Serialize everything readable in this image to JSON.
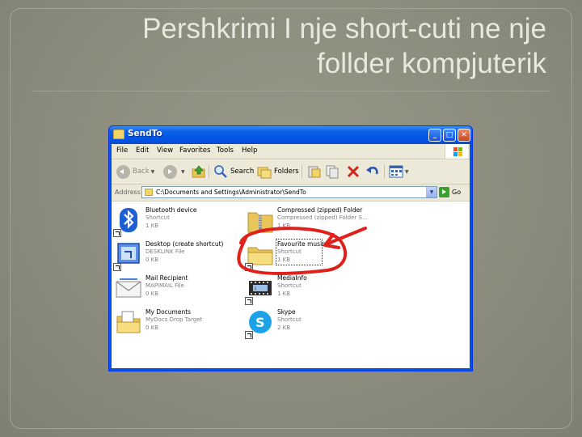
{
  "slide": {
    "title_line1": "Pershkrimi I nje short-cuti ne nje",
    "title_line2": "follder kompjuterik"
  },
  "window": {
    "title": "SendTo",
    "menu": [
      "File",
      "Edit",
      "View",
      "Favorites",
      "Tools",
      "Help"
    ],
    "toolbar": {
      "back_label": "Back",
      "search_label": "Search",
      "folders_label": "Folders"
    },
    "address": {
      "label": "Address",
      "value": "C:\\Documents and Settings\\Administrator\\SendTo",
      "go_label": "Go"
    },
    "files": [
      {
        "name": "Bluetooth device",
        "type": "Shortcut",
        "size": "1 KB",
        "icon": "bluetooth-icon"
      },
      {
        "name": "Compressed (zipped) Folder",
        "type": "Compressed (zipped) Folder S...",
        "size": "1 KB",
        "icon": "zip-folder-icon"
      },
      {
        "name": "Desktop (create shortcut)",
        "type": "DESKLINK File",
        "size": "0 KB",
        "icon": "desktop-icon"
      },
      {
        "name": "Favourite music",
        "type": "Shortcut",
        "size": "1 KB",
        "icon": "folder-icon",
        "selected": true
      },
      {
        "name": "Mail Recipient",
        "type": "MAPIMAIL File",
        "size": "0 KB",
        "icon": "mail-icon"
      },
      {
        "name": "MediaInfo",
        "type": "Shortcut",
        "size": "1 KB",
        "icon": "mediainfo-icon"
      },
      {
        "name": "My Documents",
        "type": "MyDocs Drop Target",
        "size": "0 KB",
        "icon": "my-documents-icon"
      },
      {
        "name": "Skype",
        "type": "Shortcut",
        "size": "2 KB",
        "icon": "skype-icon"
      }
    ]
  },
  "colors": {
    "background": "#8a8b7c",
    "title_text": "#e9e8df",
    "annotation": "#e0201a",
    "xp_blue": "#0054e3"
  }
}
